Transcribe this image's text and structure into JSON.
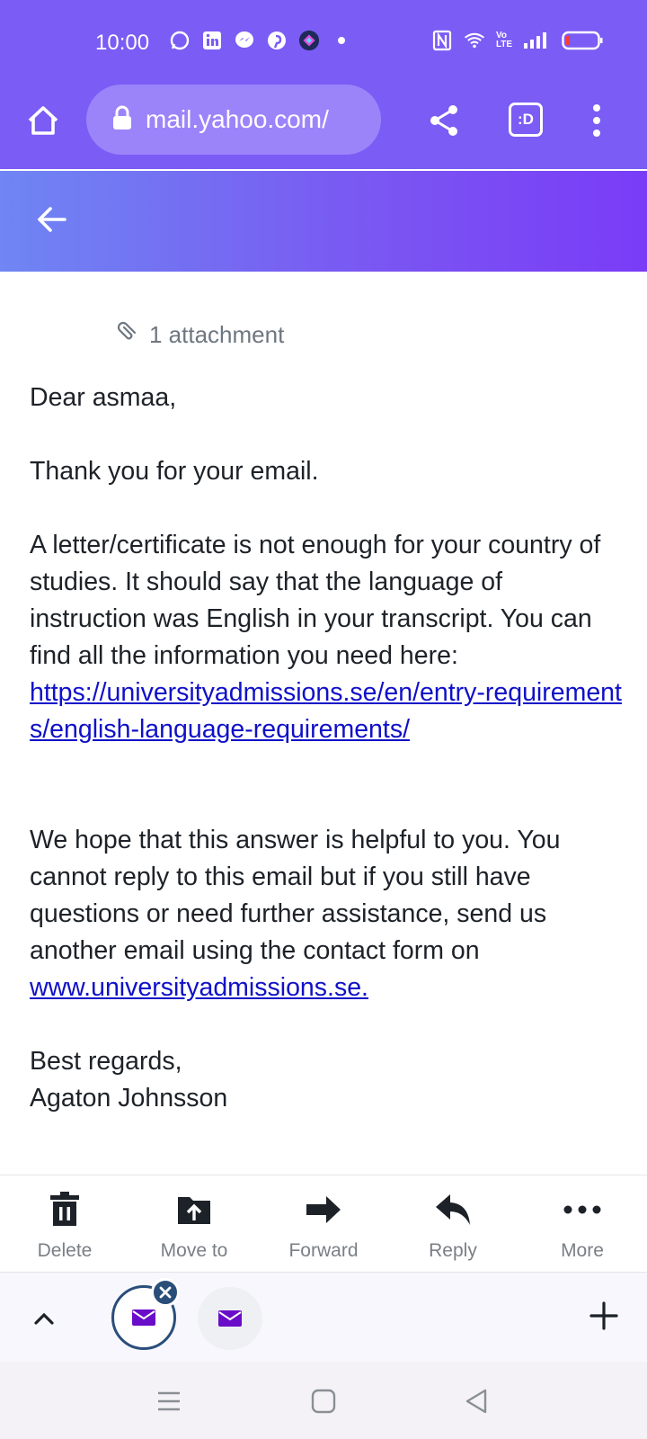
{
  "status_bar": {
    "time": "10:00",
    "left_icons": [
      "whatsapp-icon",
      "linkedin-icon",
      "messenger-icon",
      "pinterest-icon",
      "app-icon",
      "dot-icon"
    ],
    "right_icons": [
      "nfc-icon",
      "wifi-icon",
      "volte-icon",
      "signal-icon",
      "battery-icon"
    ],
    "volte_label": "Vo LTE"
  },
  "browser": {
    "url": "mail.yahoo.com/",
    "tab_label": ":D"
  },
  "email": {
    "attachment_text": "1 attachment",
    "greeting": "Dear asmaa,",
    "thanks": "Thank you for your email.",
    "para1": "A letter/certificate is not enough for your country of studies. It should say that the language of instruction was English in your transcript. You can find all the information you need here:",
    "link1": "https://universityadmissions.se/en/entry-requirements/english-language-requirements/",
    "para2_prefix": "We hope that this answer is helpful to you. You cannot reply to this email but if you still have questions or need further assistance, send us another email using the contact form on",
    "link2": "www.universityadmissions.se.",
    "closing": "Best regards,",
    "signature": "Agaton Johnsson"
  },
  "actions": {
    "delete": "Delete",
    "move_to": "Move to",
    "forward": "Forward",
    "reply": "Reply",
    "more": "More"
  },
  "colors": {
    "header": "#7b5cf5",
    "link": "#1010c8",
    "mail_icon": "#6a0dc8",
    "tab_ring": "#2a4e7a"
  }
}
